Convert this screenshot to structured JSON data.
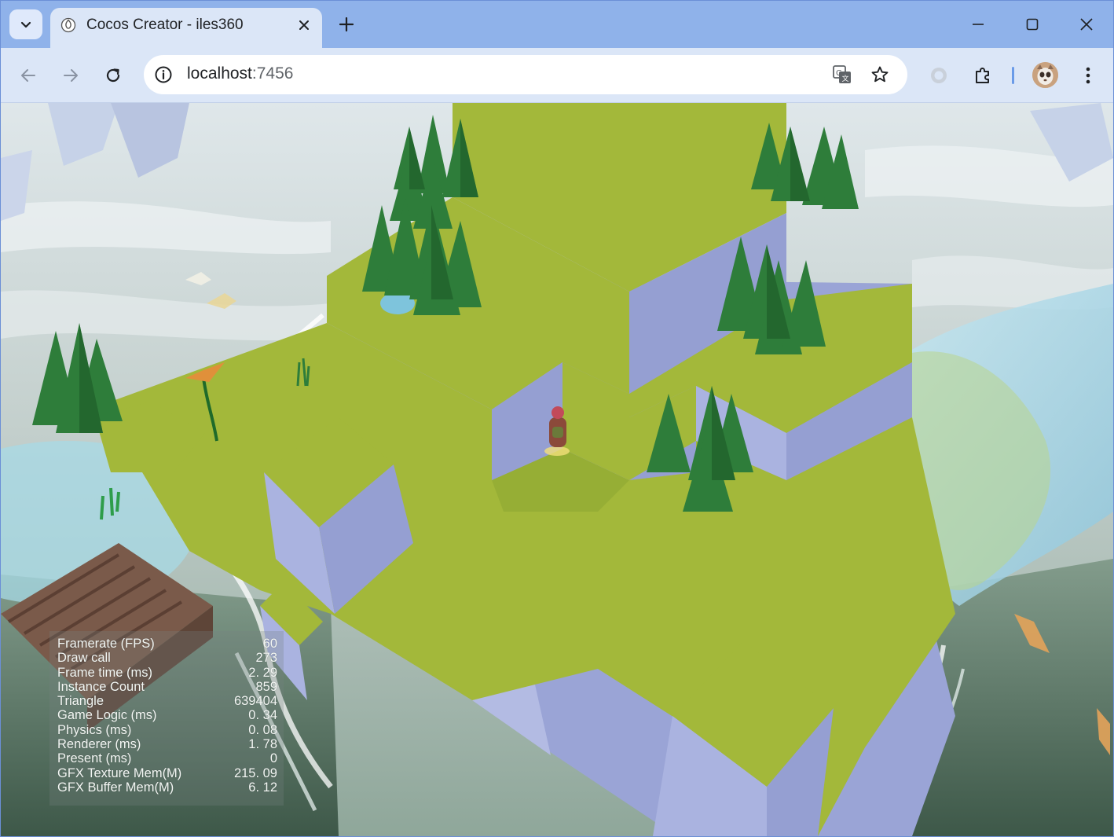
{
  "browser": {
    "tab": {
      "title": "Cocos Creator - iles360",
      "favicon": "cocos-logo-icon"
    },
    "address": {
      "host": "localhost",
      "port": ":7456"
    },
    "icons": {
      "tab_search": "chevron-down-icon",
      "tab_close": "close-icon",
      "new_tab": "plus-icon",
      "minimize": "minimize-icon",
      "maximize": "maximize-icon",
      "close": "close-icon",
      "back": "arrow-left-icon",
      "forward": "arrow-right-icon",
      "reload": "reload-icon",
      "site_info": "info-icon",
      "translate": "translate-icon",
      "bookmark": "star-icon",
      "extension_circle": "circle-icon",
      "extensions": "puzzle-icon",
      "profile": "avatar-icon",
      "menu": "kebab-menu-icon"
    },
    "colors": {
      "tabstrip": "#8fb2ea",
      "toolbar": "#dbe6f7",
      "accent": "#6a9be8"
    }
  },
  "stats": [
    {
      "label": "Framerate (FPS)",
      "value": "60"
    },
    {
      "label": "Draw call",
      "value": "273"
    },
    {
      "label": "Frame time (ms)",
      "value": "2. 29"
    },
    {
      "label": "Instance Count",
      "value": "859"
    },
    {
      "label": "Triangle",
      "value": "639404"
    },
    {
      "label": "Game Logic (ms)",
      "value": "0. 34"
    },
    {
      "label": "Physics (ms)",
      "value": "0. 08"
    },
    {
      "label": "Renderer (ms)",
      "value": "1. 78"
    },
    {
      "label": "Present (ms)",
      "value": "0"
    },
    {
      "label": "GFX Texture Mem(M)",
      "value": "215. 09"
    },
    {
      "label": "GFX Buffer Mem(M)",
      "value": "6. 12"
    }
  ],
  "scene": {
    "colors": {
      "grass": "#a3b83a",
      "grass_dark": "#8ea632",
      "cliff": "#a9b2dc",
      "cliff_shade": "#8e98c8",
      "pine": "#2e7d3a",
      "pine_dark": "#1f5e2a",
      "water": "#9fd3e8",
      "fog": "#c8d6d4"
    }
  }
}
